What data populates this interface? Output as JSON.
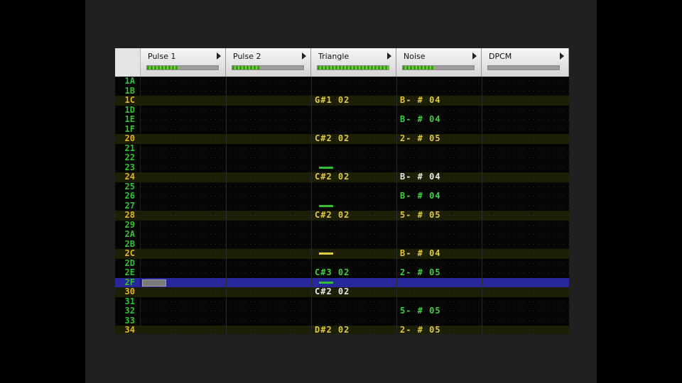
{
  "channels": [
    {
      "name": "Pulse 1",
      "volume": 0.45
    },
    {
      "name": "Pulse 2",
      "volume": 0.38
    },
    {
      "name": "Triangle",
      "volume": 1.0
    },
    {
      "name": "Noise",
      "volume": 0.45
    },
    {
      "name": "DPCM",
      "volume": 0.0
    }
  ],
  "rows": [
    {
      "num": "1A"
    },
    {
      "num": "1B"
    },
    {
      "num": "1C",
      "triangle": "G#1 02",
      "noise": "B- # 04"
    },
    {
      "num": "1D"
    },
    {
      "num": "1E",
      "noise": "B- # 04"
    },
    {
      "num": "1F"
    },
    {
      "num": "20",
      "triangle": "C#2 02",
      "noise": "2- # 05"
    },
    {
      "num": "21"
    },
    {
      "num": "22"
    },
    {
      "num": "23",
      "triangle_mark": "green"
    },
    {
      "num": "24",
      "triangle": "C#2 02",
      "noise": "B- # 04"
    },
    {
      "num": "25"
    },
    {
      "num": "26",
      "noise": "B- # 04"
    },
    {
      "num": "27",
      "triangle_mark": "green"
    },
    {
      "num": "28",
      "triangle": "C#2 02",
      "noise": "5- # 05"
    },
    {
      "num": "29"
    },
    {
      "num": "2A"
    },
    {
      "num": "2B"
    },
    {
      "num": "2C",
      "triangle_mark": "yellow",
      "noise": "B- # 04"
    },
    {
      "num": "2D"
    },
    {
      "num": "2E",
      "triangle": "C#3 02",
      "noise": "2- # 05"
    },
    {
      "num": "2F",
      "triangle_mark": "green"
    },
    {
      "num": "30",
      "triangle": "C#2 02"
    },
    {
      "num": "31"
    },
    {
      "num": "32",
      "noise": "5- # 05"
    },
    {
      "num": "33"
    },
    {
      "num": "34",
      "triangle": "D#2 02",
      "noise": "2- # 05"
    }
  ],
  "highlight_rows": [
    "1C",
    "20",
    "24",
    "28",
    "2C",
    "30",
    "34"
  ],
  "cursor_row": "2F",
  "colors": {
    "row_number": "#33c233",
    "beat_row_number": "#e0b628",
    "cursor_row": "#28289a",
    "volume_fill": "#5cc02a"
  }
}
